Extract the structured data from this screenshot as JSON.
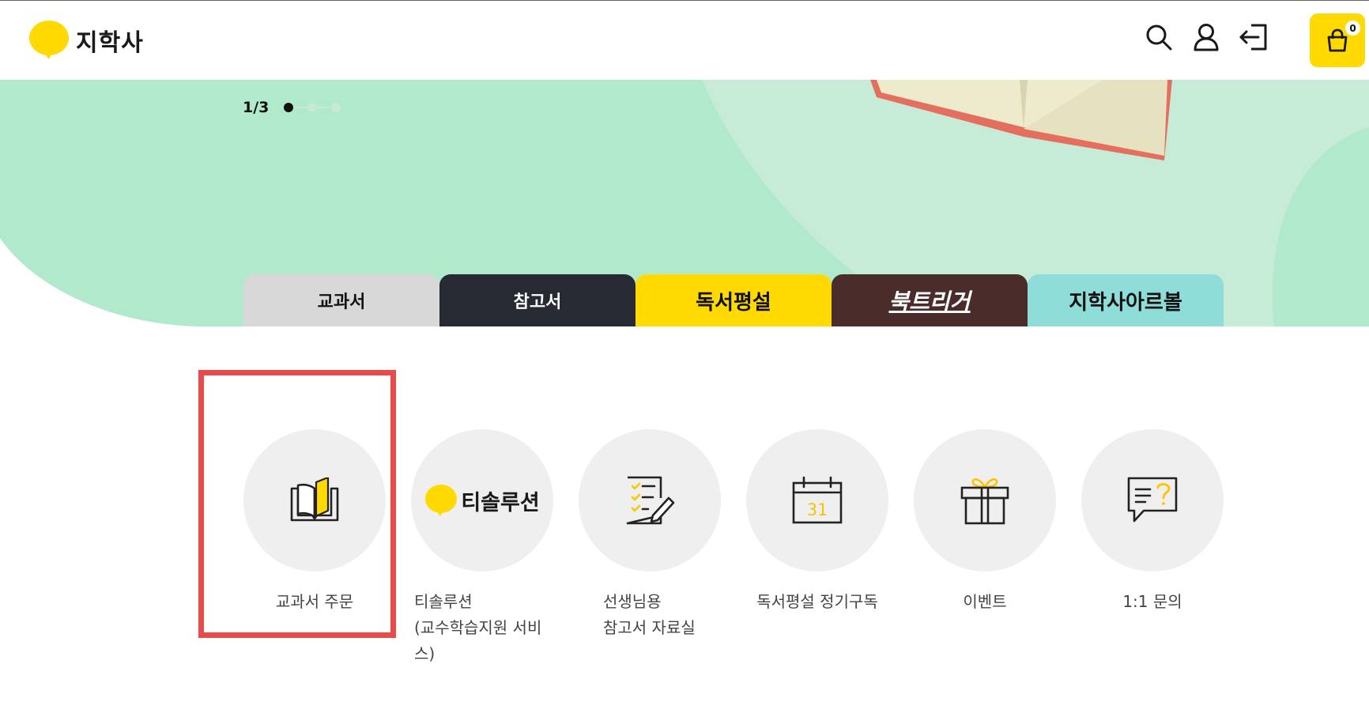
{
  "header": {
    "logo_text": "지학사",
    "cart_count": "0",
    "icons": [
      "search-icon",
      "user-icon",
      "login-icon",
      "shopping-bag-icon"
    ]
  },
  "hero": {
    "slide_counter": "1/3",
    "active_slide": 1,
    "total_slides": 3
  },
  "tabs": [
    {
      "label": "교과서"
    },
    {
      "label": "참고서"
    },
    {
      "label": "독서평설"
    },
    {
      "label": "북트리거"
    },
    {
      "label": "지학사아르볼"
    }
  ],
  "menu": [
    {
      "icon": "book-open-icon",
      "label_line1": "교과서 주문",
      "label_line2": ""
    },
    {
      "icon_badge": "지학사",
      "icon_text": "티솔루션",
      "label_line1": "티솔루션",
      "label_line2": "(교수학습지원 서비스)"
    },
    {
      "icon": "checklist-pen-icon",
      "label_line1": "선생님용",
      "label_line2": "참고서 자료실"
    },
    {
      "icon": "calendar-icon",
      "calendar_day": "31",
      "label_line1": "독서평설 정기구독",
      "label_line2": ""
    },
    {
      "icon": "gift-icon",
      "label_line1": "이벤트",
      "label_line2": ""
    },
    {
      "icon": "chat-question-icon",
      "label_line1": "1:1 문의",
      "label_line2": ""
    }
  ],
  "colors": {
    "brand_yellow": "#ffd900",
    "hero_mint": "#b0e9cb",
    "hero_mint_light": "#c6ecd8",
    "highlight_red": "#e84b4b"
  }
}
